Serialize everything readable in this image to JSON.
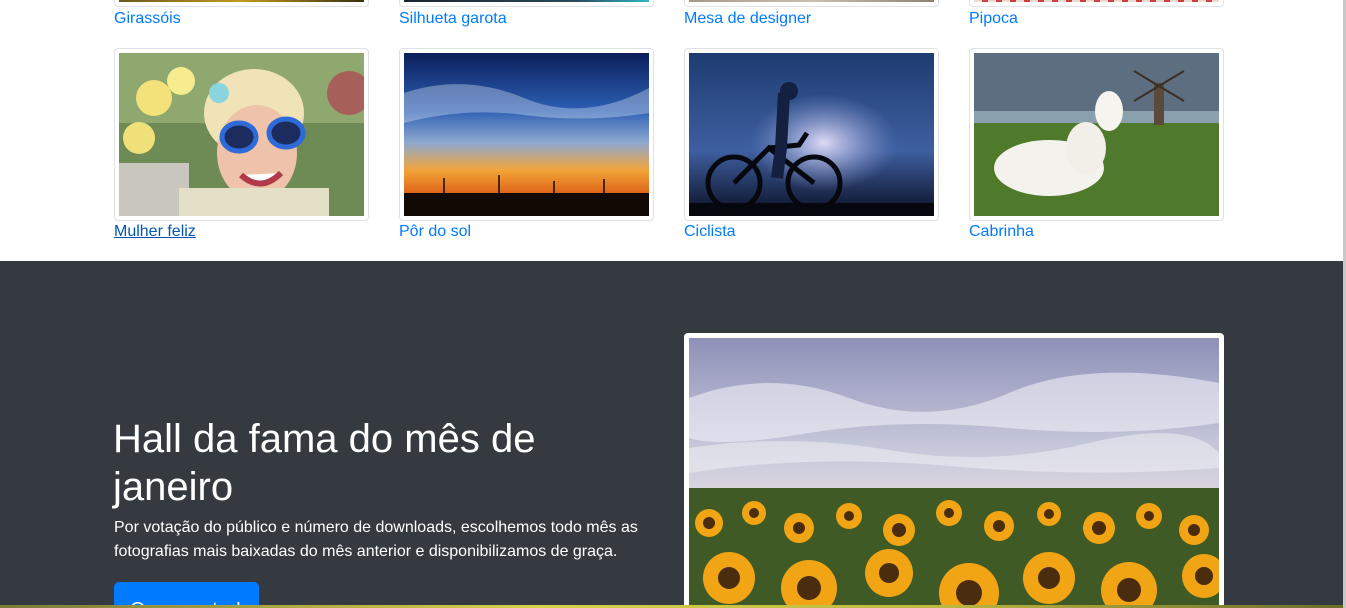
{
  "top_row": [
    {
      "caption": "Girassóis"
    },
    {
      "caption": "Silhueta garota"
    },
    {
      "caption": "Mesa de designer"
    },
    {
      "caption": "Pipoca"
    }
  ],
  "gallery": [
    {
      "caption": "Mulher feliz",
      "image": "happy-woman-photo"
    },
    {
      "caption": "Pôr do sol",
      "image": "sunset-photo"
    },
    {
      "caption": "Ciclista",
      "image": "cyclist-photo"
    },
    {
      "caption": "Cabrinha",
      "image": "goat-photo"
    }
  ],
  "hall": {
    "title": "Hall da fama do mês de janeiro",
    "description": "Por votação do público e número de downloads, escolhemos todo mês as fotografias mais baixadas do mês anterior e disponibilizamos de graça.",
    "button_label": "Quero votar!",
    "feature_image": "sunflower-field-photo"
  },
  "colors": {
    "link": "#007bff",
    "dark_bg": "#343a40",
    "button": "#007bff"
  }
}
